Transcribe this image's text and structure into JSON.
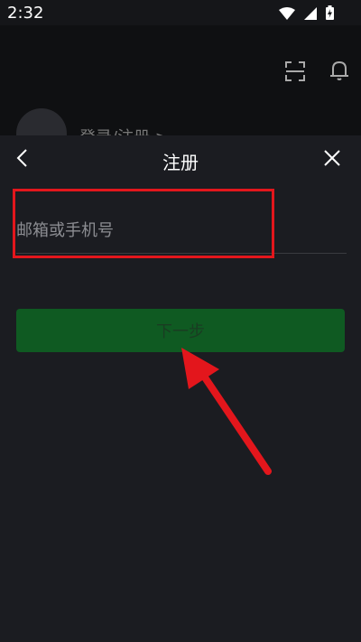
{
  "status_bar": {
    "time": "2:32"
  },
  "background": {
    "login_label": "登录/注册 >"
  },
  "sheet": {
    "title": "注册",
    "input_placeholder": "邮箱或手机号",
    "next_label": "下一步"
  },
  "colors": {
    "background": "#151619",
    "sheet": "#1b1c21",
    "button": "#0f5a22",
    "highlight": "#e3161c"
  },
  "icons": [
    "wifi-icon",
    "signal-icon",
    "battery-icon",
    "scan-icon",
    "bell-icon",
    "back-icon",
    "close-icon",
    "arrow-annotation"
  ]
}
